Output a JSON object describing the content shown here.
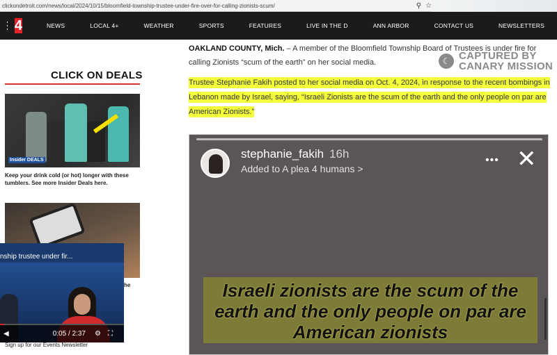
{
  "browser": {
    "url": "clickondetroit.com/news/local/2024/10/15/bloomfield-township-trustee-under-fire-over-for-calling-zionists-scum/",
    "icons": [
      "zoom-icon",
      "star-icon"
    ]
  },
  "nav": {
    "logo": "4",
    "links": [
      "NEWS",
      "LOCAL 4+",
      "WEATHER",
      "SPORTS",
      "FEATURES",
      "LIVE IN THE D",
      "ANN ARBOR",
      "CONTACT US",
      "NEWSLETTERS"
    ]
  },
  "sidebar": {
    "deals_title": "CLICK ON DEALS",
    "deal1_caption": "Keep your drink cold (or hot) longer with these tumblers. See more Insider Deals here.",
    "deal1_badge": "Insider DEALS",
    "partial_text": "he",
    "signup_text": "Sign up for our Events Newsletter"
  },
  "video": {
    "title": "nship trustee under fir...",
    "time": "0:05 / 2:37",
    "progress": 0.032
  },
  "article": {
    "dateline_bold": "OAKLAND COUNTY, Mich.",
    "dateline_rest": " – A member of the Bloomfield Township Board of Trustees is under fire for calling Zionists “scum of the earth” on her social media.",
    "highlight_paragraph": "Trustee Stephanie Fakih posted to her social media on Oct. 4, 2024, in response to the recent bombings in Lebanon made by Israel, saying, “Israeli Zionists are the scum of the earth and the only people on par are American Zionists.”"
  },
  "watermark": {
    "line1": "CAPTURED BY",
    "line2": "CANARY MISSION"
  },
  "story": {
    "username": "stephanie_fakih",
    "age": "16h",
    "added_to": "Added to A plea 4 humans >",
    "more": "•••",
    "close": "✕",
    "quote": "Israeli zionists are the scum of the earth and the only people on par are American zionists"
  },
  "colors": {
    "nav_bg": "#1b1b1b",
    "brand_red": "#e32229",
    "highlight": "#f4ff3b"
  }
}
